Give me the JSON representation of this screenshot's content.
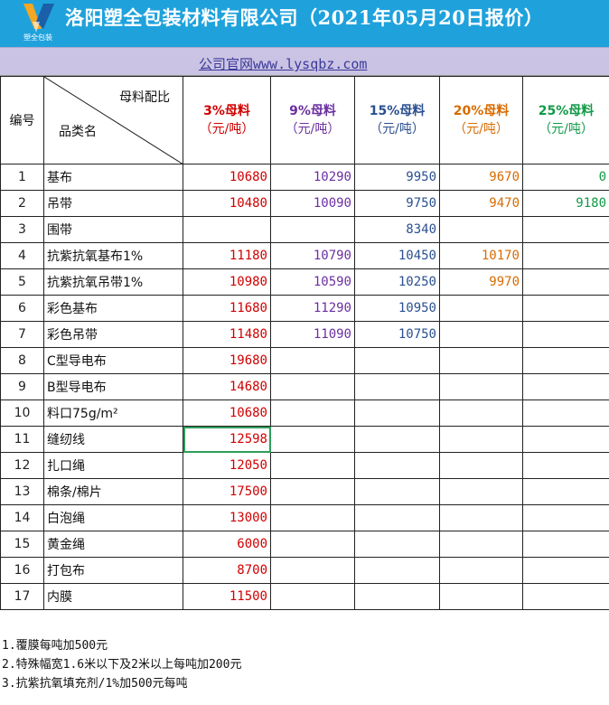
{
  "header": {
    "logo_text": "塑全包装",
    "title": "洛阳塑全包装材料有限公司（2021年05月20日报价）",
    "colors": {
      "bar": "#1fa2dc",
      "band": "#cbc3e3"
    }
  },
  "site": {
    "label": "公司官网www.lysqbz.com"
  },
  "table": {
    "index_header": "编号",
    "diag_top": "母料配比",
    "diag_bottom": "品类名",
    "columns": [
      {
        "pct": "3%母料",
        "unit": "（元/吨）",
        "color": "#d00000"
      },
      {
        "pct": "9%母料",
        "unit": "（元/吨）",
        "color": "#6b2fa0"
      },
      {
        "pct": "15%母料",
        "unit": "（元/吨）",
        "color": "#2b4f91"
      },
      {
        "pct": "20%母料",
        "unit": "（元/吨）",
        "color": "#d86b00"
      },
      {
        "pct": "25%母料",
        "unit": "（元/吨）",
        "color": "#119a47"
      }
    ],
    "rows": [
      {
        "no": "1",
        "name": "基布",
        "v": [
          "10680",
          "10290",
          "9950",
          "9670",
          "0"
        ]
      },
      {
        "no": "2",
        "name": "吊带",
        "v": [
          "10480",
          "10090",
          "9750",
          "9470",
          "9180"
        ]
      },
      {
        "no": "3",
        "name": "围带",
        "v": [
          "",
          "",
          "8340",
          "",
          ""
        ]
      },
      {
        "no": "4",
        "name": "抗紫抗氧基布1%",
        "v": [
          "11180",
          "10790",
          "10450",
          "10170",
          ""
        ]
      },
      {
        "no": "5",
        "name": "抗紫抗氧吊带1%",
        "v": [
          "10980",
          "10590",
          "10250",
          "9970",
          ""
        ]
      },
      {
        "no": "6",
        "name": "彩色基布",
        "v": [
          "11680",
          "11290",
          "10950",
          "",
          ""
        ]
      },
      {
        "no": "7",
        "name": "彩色吊带",
        "v": [
          "11480",
          "11090",
          "10750",
          "",
          ""
        ]
      },
      {
        "no": "8",
        "name": "C型导电布",
        "v": [
          "19680",
          "",
          "",
          "",
          ""
        ]
      },
      {
        "no": "9",
        "name": "B型导电布",
        "v": [
          "14680",
          "",
          "",
          "",
          ""
        ]
      },
      {
        "no": "10",
        "name": "料口75g/m²",
        "v": [
          "10680",
          "",
          "",
          "",
          ""
        ]
      },
      {
        "no": "11",
        "name": "缝纫线",
        "v": [
          "12598",
          "",
          "",
          "",
          ""
        ]
      },
      {
        "no": "12",
        "name": "扎口绳",
        "v": [
          "12050",
          "",
          "",
          "",
          ""
        ]
      },
      {
        "no": "13",
        "name": "棉条/棉片",
        "v": [
          "17500",
          "",
          "",
          "",
          ""
        ]
      },
      {
        "no": "14",
        "name": "白泡绳",
        "v": [
          "13000",
          "",
          "",
          "",
          ""
        ]
      },
      {
        "no": "15",
        "name": "黄金绳",
        "v": [
          "6000",
          "",
          "",
          "",
          ""
        ]
      },
      {
        "no": "16",
        "name": "打包布",
        "v": [
          "8700",
          "",
          "",
          "",
          ""
        ]
      },
      {
        "no": "17",
        "name": "内膜",
        "v": [
          "11500",
          "",
          "",
          "",
          ""
        ]
      }
    ],
    "selected_cell": {
      "row": 11,
      "col": 1
    }
  },
  "notes": [
    "1.覆膜每吨加500元",
    "2.特殊幅宽1.6米以下及2米以上每吨加200元",
    "3.抗紫抗氧填充剂/1%加500元每吨"
  ]
}
